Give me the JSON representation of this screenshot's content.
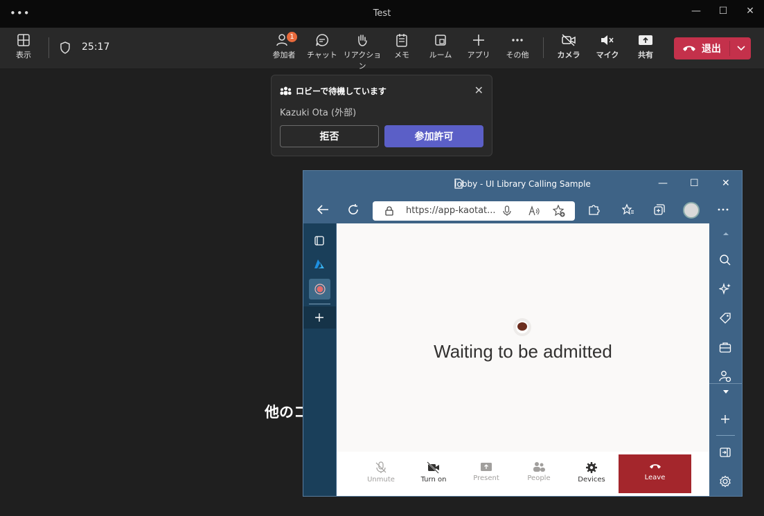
{
  "window": {
    "title": "Test"
  },
  "toolbar": {
    "view_label": "表示",
    "timer": "25:17",
    "participants_label": "参加者",
    "participants_badge": "1",
    "chat_label": "チャット",
    "reactions_label": "リアクション",
    "notes_label": "メモ",
    "rooms_label": "ルーム",
    "apps_label": "アプリ",
    "more_label": "その他",
    "camera_label": "カメラ",
    "mic_label": "マイク",
    "share_label": "共有",
    "leave_label": "退出"
  },
  "lobby": {
    "title": "ロビーで待機しています",
    "person": "Kazuki Ota (外部)",
    "deny_label": "拒否",
    "admit_label": "参加許可"
  },
  "background_text": "他のコ",
  "browser": {
    "title": "lobby - UI Library Calling Sample",
    "url": "https://app-kaotat..."
  },
  "app": {
    "status": "Waiting to be admitted",
    "controls": {
      "unmute": "Unmute",
      "turn_on": "Turn on",
      "present": "Present",
      "people": "People",
      "devices": "Devices",
      "leave": "Leave"
    }
  },
  "colors": {
    "teams_leave": "#c4314b",
    "admit_purple": "#5b5fc7",
    "browser_frame": "#3e6386",
    "app_leave": "#a4262c"
  }
}
